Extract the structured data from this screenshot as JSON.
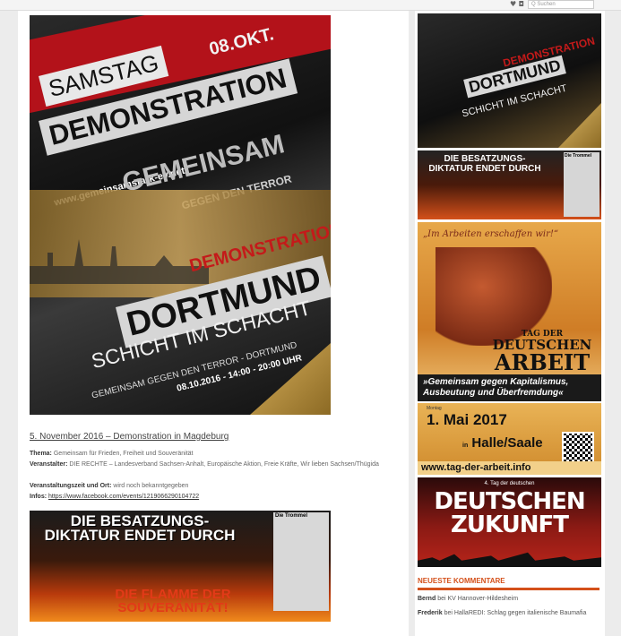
{
  "topbar": {
    "icons": "♥ ◘",
    "search_placeholder": "Q Suchen"
  },
  "main": {
    "poster": {
      "kicker": "SAMSTAG",
      "date": "08.OKT.",
      "title": "DEMONSTRATION",
      "url": "www.gemeinsamstark-ev.net",
      "slogan_big": "GEMEINSAM",
      "slogan_small": "GEGEN DEN TERROR",
      "red": "DEMONSTRATION",
      "city": "DORTMUND",
      "motto": "SCHICHT IM SCHACHT",
      "sub": "GEMEINSAM GEGEN DEN TERROR - DORTMUND",
      "time": "08.10.2016 - 14:00 - 20:00 UHR"
    },
    "post_title": "5. November 2016 – Demonstration in Magdeburg",
    "meta": {
      "thema_label": "Thema:",
      "thema_value": "Gemeinsam für Frieden, Freiheit und Souveränität",
      "veranst_label": "Veranstalter:",
      "veranst_value": "DIE RECHTE – Landesverband Sachsen-Anhalt, Europäische Aktion, Freie Kräfte, Wir lieben Sachsen/Thügida",
      "zeit_label": "Veranstaltungszeit und Ort:",
      "zeit_value": "wird noch bekanntgegeben",
      "infos_label": "Infos:",
      "infos_value": "https://www.facebook.com/events/1219066290104722"
    },
    "banner": {
      "headline": "DIE BESATZUNGS-DIKTATUR ENDET DURCH",
      "flame": "DIE FLAMME DER SOUVERÄNITÄT!",
      "paper": "Die Trommel"
    }
  },
  "sidebar": {
    "b1": {
      "red": "DEMONSTRATION",
      "city": "DORTMUND",
      "motto": "SCHICHT IM SCHACHT"
    },
    "b2": {
      "headline": "DIE BESATZUNGS-DIKTATUR ENDET DURCH",
      "paper": "Die Trommel"
    },
    "b3": {
      "quote": "„Im Arbeiten erschaffen wir!“",
      "tag1": "TAG DER",
      "tag2": "DEUTSCHEN",
      "tag3": "ARBEIT",
      "bar": "»Gemeinsam gegen Kapitalismus, Ausbeutung und Überfremdung«"
    },
    "b4": {
      "kicker": "Montag",
      "date": "1. Mai 2017",
      "place_prefix": "in",
      "place": "Halle/Saale",
      "url": "www.tag-der-arbeit.info"
    },
    "b5": {
      "kicker": "4. Tag der deutschen",
      "title": "DEUTSCHEN ZUKUNFT"
    },
    "heading": "NEUESTE KOMMENTARE",
    "comments": [
      {
        "author": "Bernd",
        "mid": "bei",
        "target": "KV Hannover-Hildesheim"
      },
      {
        "author": "Frederik",
        "mid": "bei",
        "target": "HallaREDI: Schlag gegen italienische Baumafia"
      }
    ]
  }
}
